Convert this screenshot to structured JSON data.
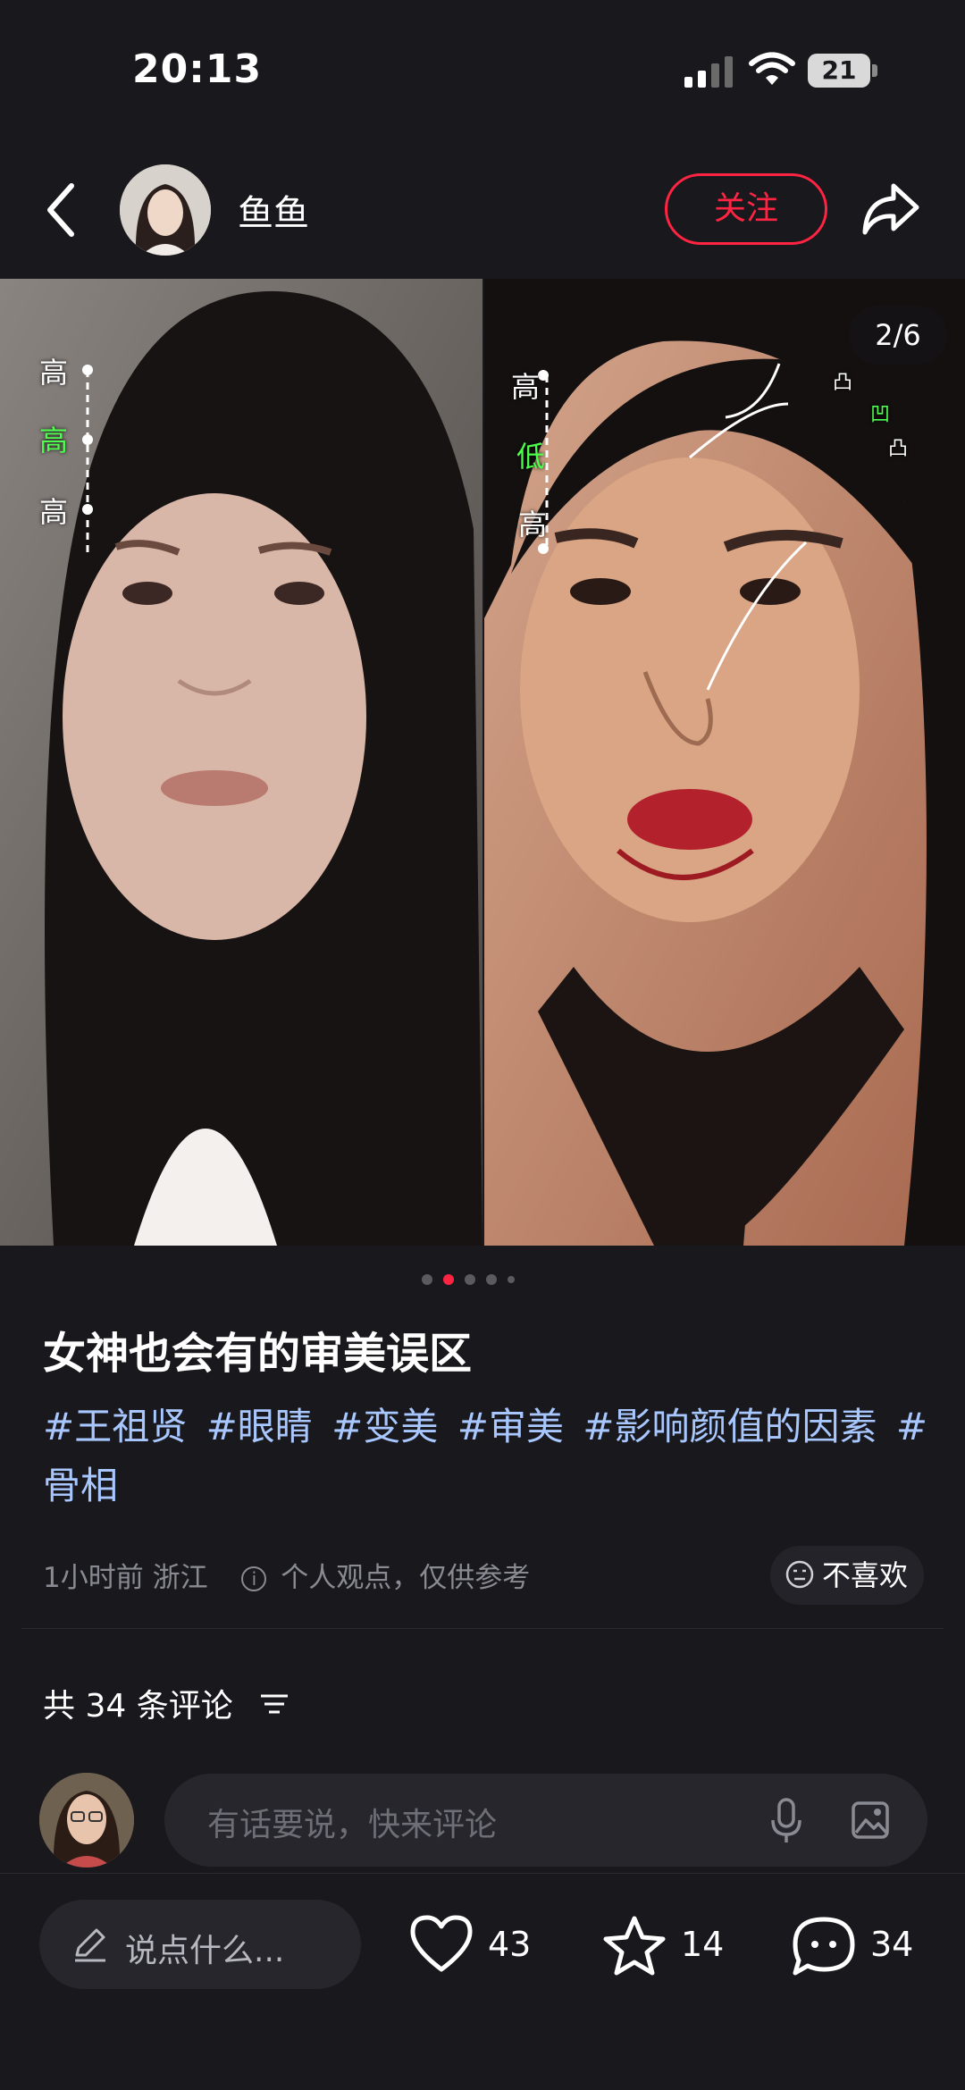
{
  "status_bar": {
    "time": "20:13",
    "battery": "21"
  },
  "header": {
    "author": "鱼鱼",
    "follow_label": "关注"
  },
  "media": {
    "counter": "2/6",
    "left_marks": [
      "高",
      "高",
      "高"
    ],
    "right_marks": [
      "高",
      "低",
      "高"
    ],
    "right_curve_marks": [
      "凸",
      "凹",
      "凸"
    ]
  },
  "post": {
    "title": "女神也会有的审美误区",
    "tags": [
      "#王祖贤",
      "#眼睛",
      "#变美",
      "#审美",
      "#影响颜值的因素",
      "#骨相"
    ],
    "time_location": "1小时前 浙江",
    "notice": "个人观点，仅供参考",
    "dislike_label": "不喜欢"
  },
  "comments": {
    "count_label": "共 34 条评论",
    "input_placeholder": "有话要说，快来评论"
  },
  "bottom_bar": {
    "say_placeholder": "说点什么...",
    "likes": "43",
    "favorites": "14",
    "comments": "34"
  },
  "colors": {
    "accent": "#ff2442",
    "tag": "#a9c7ff",
    "background": "#18181d"
  }
}
